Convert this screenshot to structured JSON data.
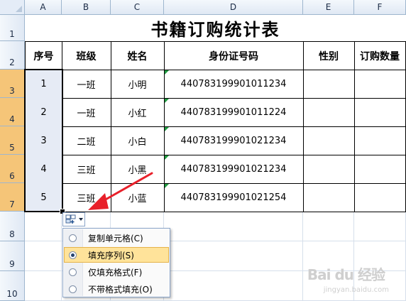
{
  "columns": [
    "A",
    "B",
    "C",
    "D",
    "E",
    "F"
  ],
  "rows": [
    "1",
    "2",
    "3",
    "4",
    "5",
    "6",
    "7",
    "8",
    "9",
    "10"
  ],
  "sheet": {
    "title": "书籍订购统计表",
    "headers": [
      "序号",
      "班级",
      "姓名",
      "身份证号码",
      "性别",
      "订购数量"
    ],
    "records": [
      {
        "no": "1",
        "class": "一班",
        "name": "小明",
        "id": "440783199901011234",
        "gender": "",
        "qty": ""
      },
      {
        "no": "2",
        "class": "一班",
        "name": "小红",
        "id": "440783199901011224",
        "gender": "",
        "qty": ""
      },
      {
        "no": "3",
        "class": "二班",
        "name": "小白",
        "id": "440783199901021234",
        "gender": "",
        "qty": ""
      },
      {
        "no": "4",
        "class": "三班",
        "name": "小黑",
        "id": "440783199901021234",
        "gender": "",
        "qty": ""
      },
      {
        "no": "5",
        "class": "三班",
        "name": "小蓝",
        "id": "440783199901021254",
        "gender": "",
        "qty": ""
      }
    ]
  },
  "autofill_menu": {
    "items": [
      {
        "label": "复制单元格(C)",
        "selected": false
      },
      {
        "label": "填充序列(S)",
        "selected": true
      },
      {
        "label": "仅填充格式(F)",
        "selected": false
      },
      {
        "label": "不带格式填充(O)",
        "selected": false
      }
    ]
  },
  "colors": {
    "arrow": "#e8202a",
    "selected_row_header": "#f5c578",
    "menu_highlight": "#ffe39a"
  },
  "watermark": {
    "main": "Bai du 经验",
    "sub": "jingyan.baidu.com"
  }
}
